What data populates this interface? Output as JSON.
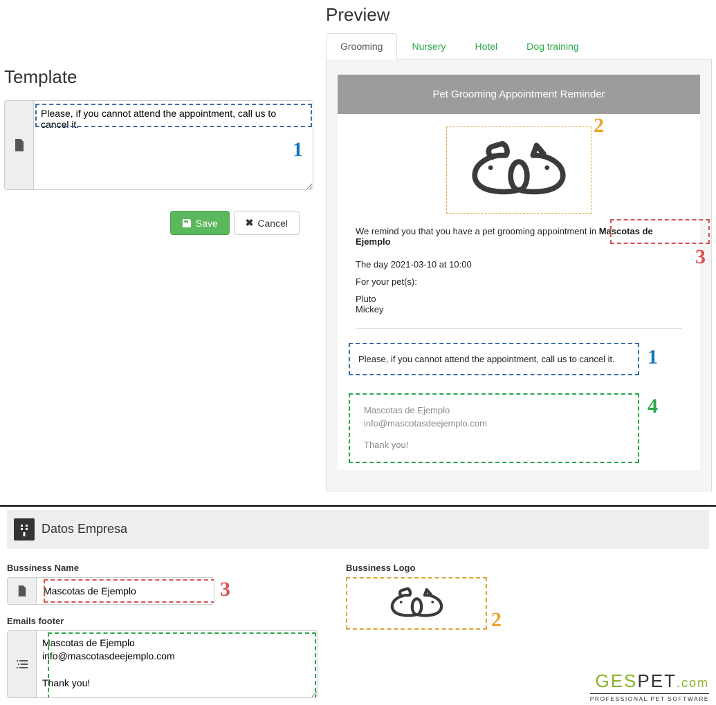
{
  "template": {
    "title": "Template",
    "textarea_value": "Please, if you cannot attend the appointment, call us to cancel it.",
    "save_label": "Save",
    "cancel_label": "Cancel"
  },
  "preview": {
    "title": "Preview",
    "tabs": [
      {
        "label": "Grooming",
        "active": true
      },
      {
        "label": "Nursery",
        "active": false
      },
      {
        "label": "Hotel",
        "active": false
      },
      {
        "label": "Dog training",
        "active": false
      }
    ],
    "card": {
      "header": "Pet Grooming Appointment Reminder",
      "line1_prefix": "We remind you that you have a pet grooming appointment in ",
      "business_name": "Mascotas de Ejemplo",
      "date_line": "The day 2021-03-10 at 10:00",
      "pets_label": "For your pet(s):",
      "pets": [
        "Pluto",
        "Mickey"
      ],
      "custom_text": "Please, if you cannot attend the appointment, call us to cancel it.",
      "footer_name": "Mascotas de Ejemplo",
      "footer_email": "info@mascotasdeejemplo.com",
      "footer_thanks": "Thank you!"
    }
  },
  "callouts": {
    "n1": "1",
    "n2": "2",
    "n3": "3",
    "n4": "4"
  },
  "company": {
    "section_title": "Datos Empresa",
    "name_label": "Bussiness Name",
    "name_value": "Mascotas de Ejemplo",
    "footer_label": "Emails footer",
    "footer_value": "Mascotas de Ejemplo\ninfo@mascotasdeejemplo.com\n\nThank you!",
    "logo_label": "Bussiness Logo"
  },
  "brand": {
    "part1": "GES",
    "part2": "PET",
    "dot": ".com",
    "sub": "PROFESSIONAL PET SOFTWARE"
  }
}
